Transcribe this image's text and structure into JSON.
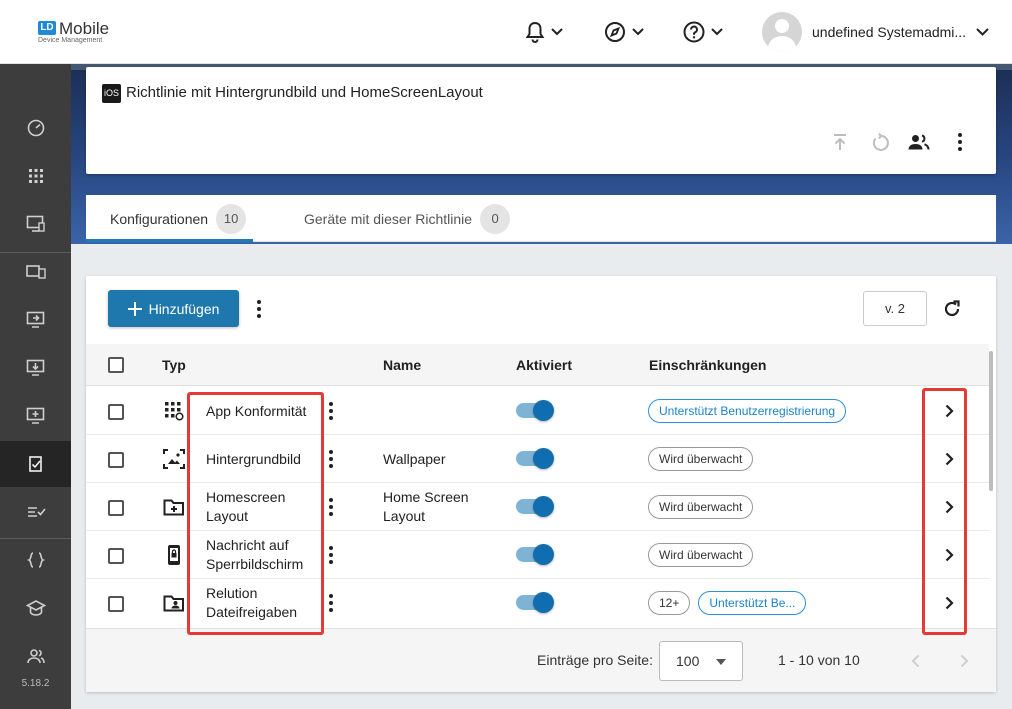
{
  "app": {
    "logo_mark": "LD",
    "logo_name": "Mobile",
    "logo_sub": "Device Management",
    "user_name": "undefined Systemadmi...",
    "version": "5.18.2"
  },
  "topbar_icons": [
    "bell-icon",
    "compass-icon",
    "help-icon"
  ],
  "sidebar_icons": [
    "dashboard-icon",
    "apps-grid-icon",
    "device-screen-icon",
    "devices-icon",
    "remote-screen-icon",
    "download-screen-icon",
    "screen-add-icon",
    "policy-check-icon",
    "checklist-icon",
    "code-braces-icon",
    "education-icon",
    "users-icon"
  ],
  "policy": {
    "platform_badge": "iOS",
    "title": "Richtlinie mit Hintergrundbild und HomeScreenLayout"
  },
  "tabs": [
    {
      "label": "Konfigurationen",
      "count": "10"
    },
    {
      "label": "Geräte mit dieser Richtlinie",
      "count": "0"
    }
  ],
  "toolbar": {
    "add_label": "Hinzufügen",
    "version_label": "v. 2"
  },
  "table": {
    "headers": {
      "type": "Typ",
      "name": "Name",
      "active": "Aktiviert",
      "restrictions": "Einschränkungen"
    },
    "rows": [
      {
        "type": "App Konformität",
        "name": "",
        "active": true,
        "chips": [
          "Unterstützt Benutzerregistrierung"
        ],
        "chip_styles": [
          "blue"
        ]
      },
      {
        "type": "Hintergrundbild",
        "name": "Wallpaper",
        "active": true,
        "chips": [
          "Wird überwacht"
        ],
        "chip_styles": [
          "grey"
        ]
      },
      {
        "type": "Homescreen Layout",
        "name": "Home Screen Layout",
        "active": true,
        "chips": [
          "Wird überwacht"
        ],
        "chip_styles": [
          "grey"
        ]
      },
      {
        "type": "Nachricht auf Sperrbildschirm",
        "name": "",
        "active": true,
        "chips": [
          "Wird überwacht"
        ],
        "chip_styles": [
          "grey"
        ]
      },
      {
        "type": "Relution Dateifreigaben",
        "name": "",
        "active": true,
        "chips": [
          "12+",
          "Unterstützt Be..."
        ],
        "chip_styles": [
          "grey",
          "blue"
        ]
      }
    ]
  },
  "pagination": {
    "per_page_label": "Einträge pro Seite:",
    "per_page_value": "100",
    "range": "1 - 10 von 10"
  },
  "colors": {
    "accent": "#1f78ad",
    "highlight": "#e53935",
    "sidebar": "#3d3d3d"
  }
}
